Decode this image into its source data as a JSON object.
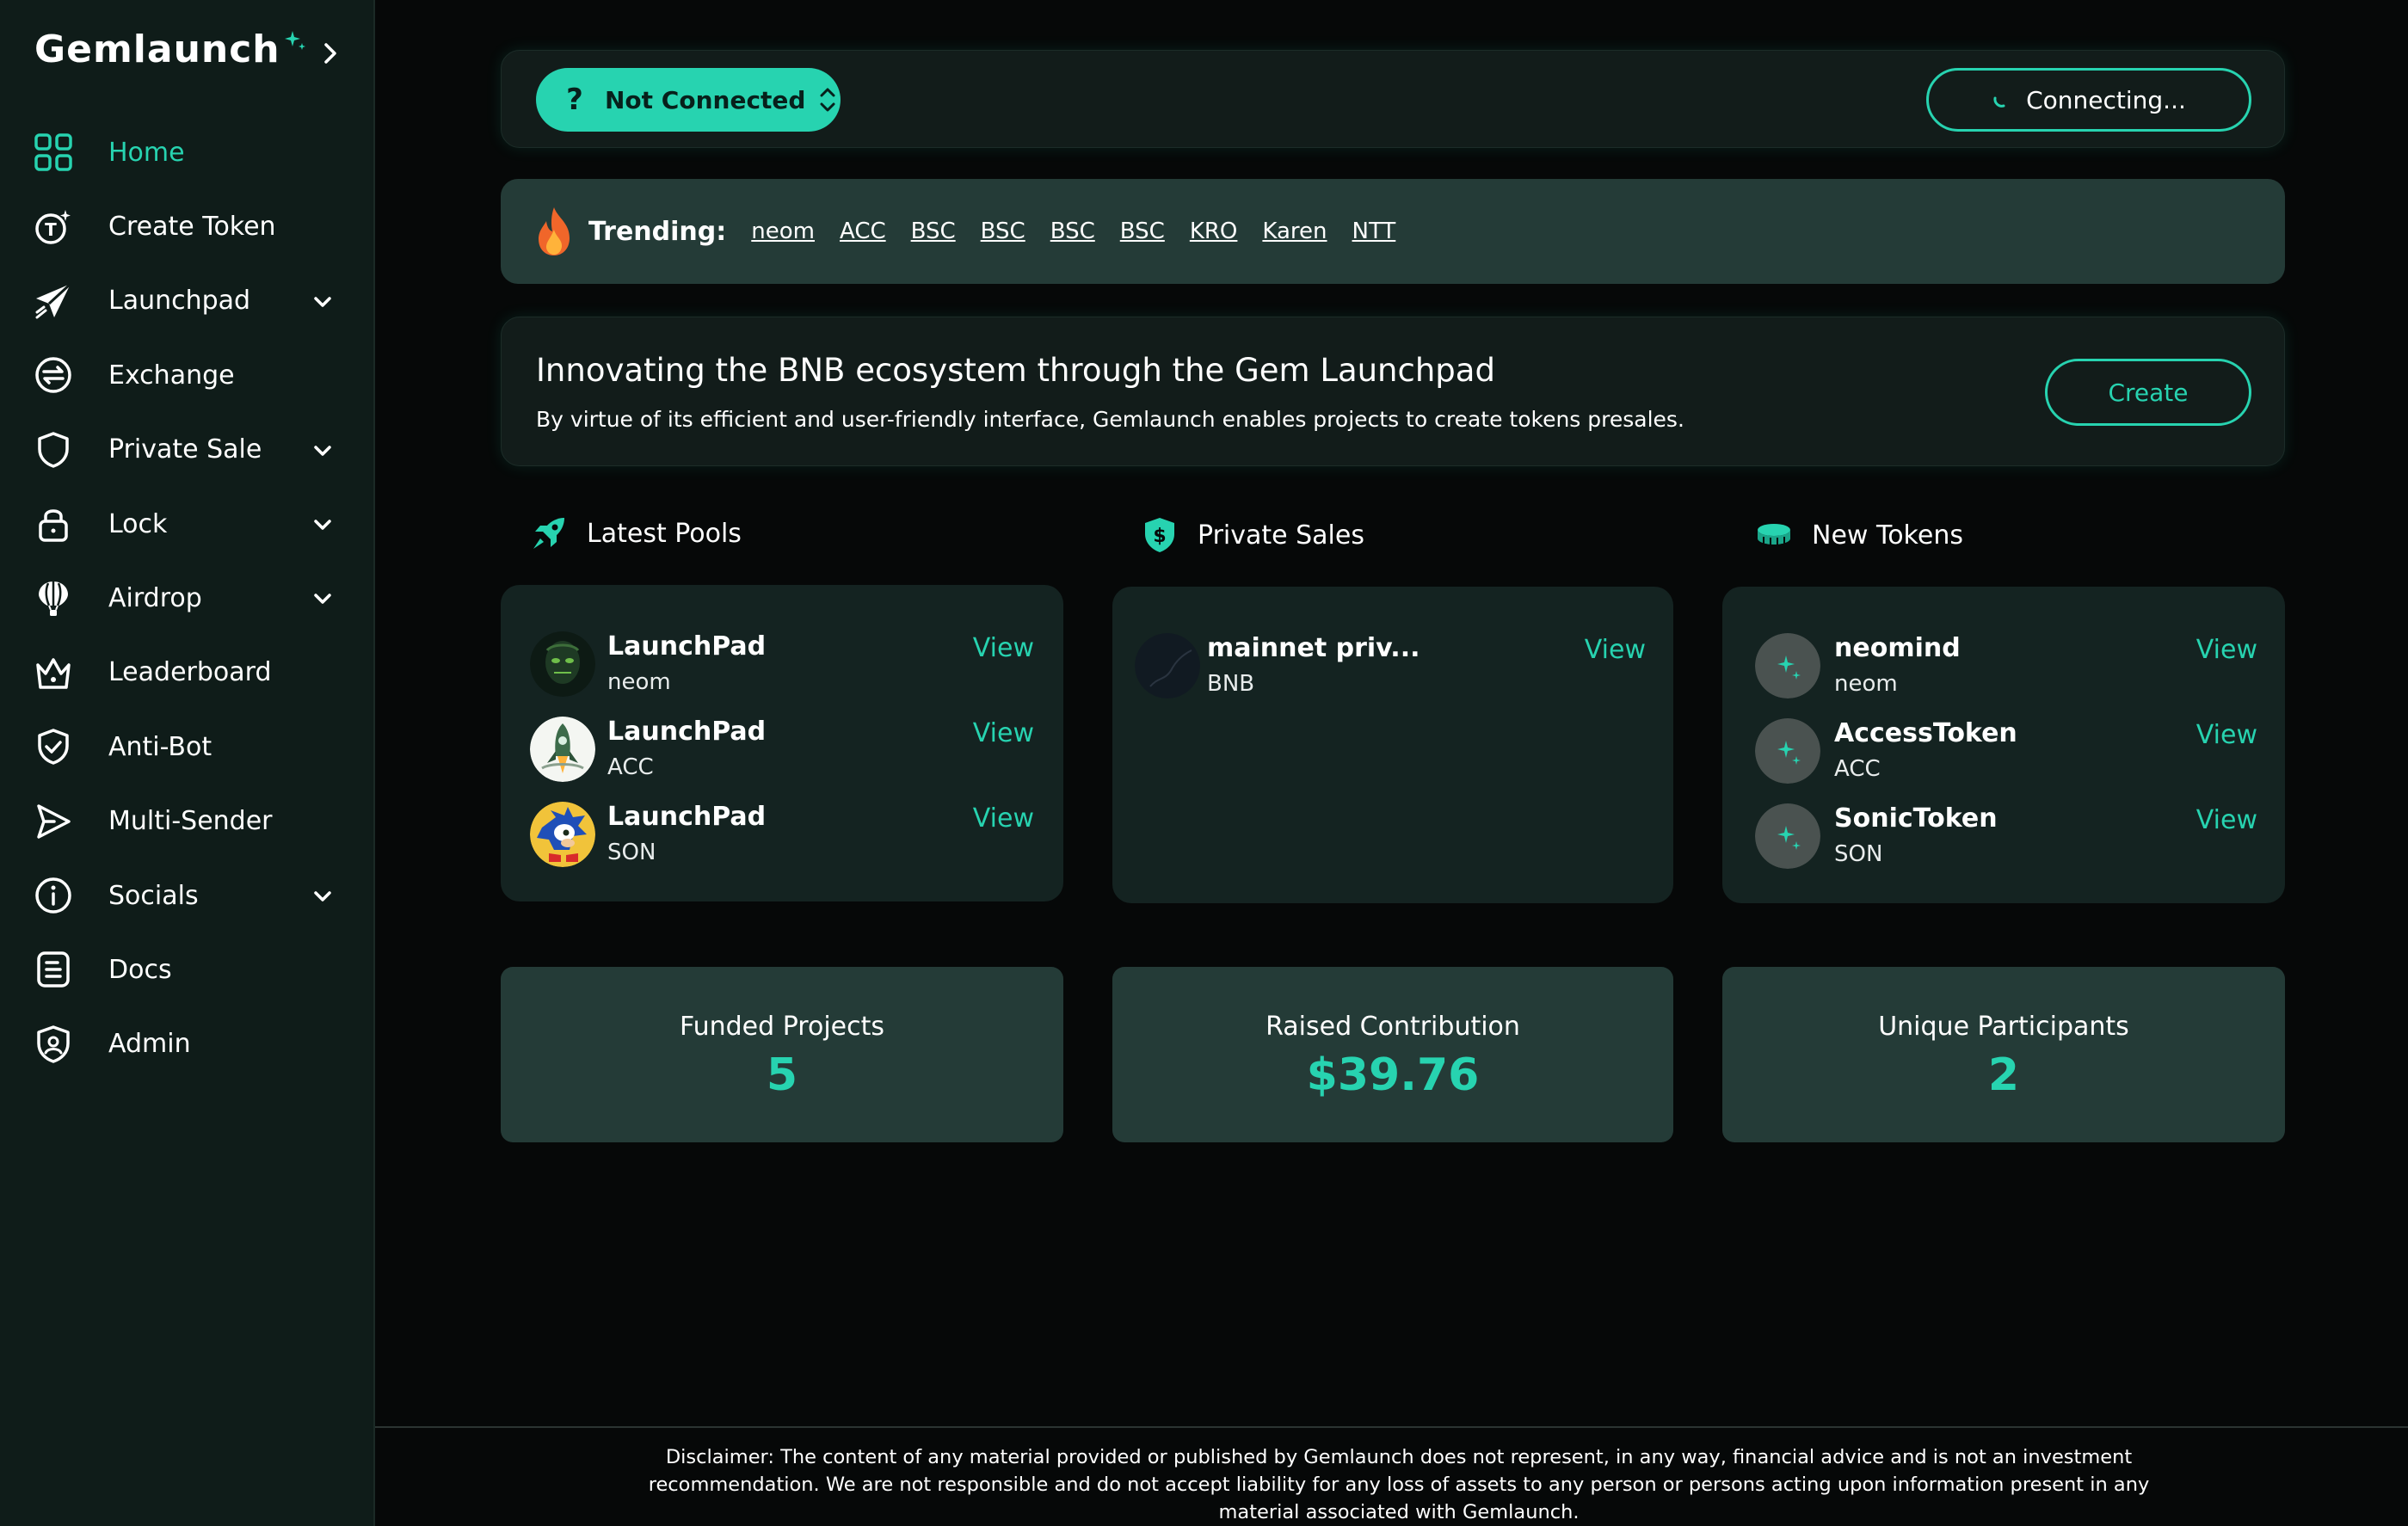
{
  "brand": {
    "name": "Gemlaunch"
  },
  "colors": {
    "accent": "#27d3b0",
    "sidebar_bg": "#0f1c19",
    "card_bg": "#121c1a",
    "panel_bg": "#243b37",
    "page_bg": "#060808"
  },
  "sidebar": {
    "items": [
      {
        "label": "Home",
        "icon": "grid-icon",
        "active": true
      },
      {
        "label": "Create Token",
        "icon": "token-icon"
      },
      {
        "label": "Launchpad",
        "icon": "paper-plane-icon",
        "expandable": true
      },
      {
        "label": "Exchange",
        "icon": "exchange-icon"
      },
      {
        "label": "Private Sale",
        "icon": "shield-icon",
        "expandable": true
      },
      {
        "label": "Lock",
        "icon": "lock-icon",
        "expandable": true
      },
      {
        "label": "Airdrop",
        "icon": "balloon-icon",
        "expandable": true
      },
      {
        "label": "Leaderboard",
        "icon": "crown-icon"
      },
      {
        "label": "Anti-Bot",
        "icon": "shield-check-icon"
      },
      {
        "label": "Multi-Sender",
        "icon": "send-icon"
      },
      {
        "label": "Socials",
        "icon": "info-icon",
        "expandable": true
      },
      {
        "label": "Docs",
        "icon": "document-icon"
      },
      {
        "label": "Admin",
        "icon": "admin-shield-icon"
      }
    ]
  },
  "topbar": {
    "network_button": "Not Connected",
    "network_icon": "question-icon",
    "wallet_button": "Connecting..."
  },
  "trending": {
    "label": "Trending:",
    "icon": "fire-icon",
    "links": [
      "neom",
      "ACC",
      "BSC",
      "BSC",
      "BSC",
      "BSC",
      "KRO",
      "Karen",
      "NTT"
    ]
  },
  "hero": {
    "title": "Innovating the BNB ecosystem through the Gem Launchpad",
    "subtitle": "By virtue of its efficient and user-friendly interface, Gemlaunch enables projects to create tokens presales.",
    "create_label": "Create"
  },
  "latest_pools": {
    "title": "Latest Pools",
    "icon": "rocket-icon",
    "items": [
      {
        "name": "LaunchPad",
        "symbol": "neom",
        "action": "View",
        "avatar": "robot-avatar"
      },
      {
        "name": "LaunchPad",
        "symbol": "ACC",
        "action": "View",
        "avatar": "rocket-avatar"
      },
      {
        "name": "LaunchPad",
        "symbol": "SON",
        "action": "View",
        "avatar": "hedgehog-avatar"
      }
    ]
  },
  "private_sales": {
    "title": "Private Sales",
    "icon": "dollar-shield-icon",
    "items": [
      {
        "name": "mainnet priv...",
        "symbol": "BNB",
        "action": "View",
        "avatar": "dark-avatar"
      }
    ]
  },
  "new_tokens": {
    "title": "New Tokens",
    "icon": "coins-icon",
    "items": [
      {
        "name": "neomind",
        "symbol": "neom",
        "action": "View",
        "avatar": "sparkle-avatar"
      },
      {
        "name": "AccessToken",
        "symbol": "ACC",
        "action": "View",
        "avatar": "sparkle-avatar"
      },
      {
        "name": "SonicToken",
        "symbol": "SON",
        "action": "View",
        "avatar": "sparkle-avatar"
      }
    ]
  },
  "stats": [
    {
      "label": "Funded Projects",
      "value": "5"
    },
    {
      "label": "Raised Contribution",
      "value": "$39.76"
    },
    {
      "label": "Unique Participants",
      "value": "2"
    }
  ],
  "footer": {
    "disclaimer": "Disclaimer: The content of any material provided or published by Gemlaunch does not represent, in any way, financial advice and is not an investment recommendation. We are not responsible and do not accept liability for any loss of assets to any person or persons acting upon information present in any material associated with Gemlaunch."
  }
}
